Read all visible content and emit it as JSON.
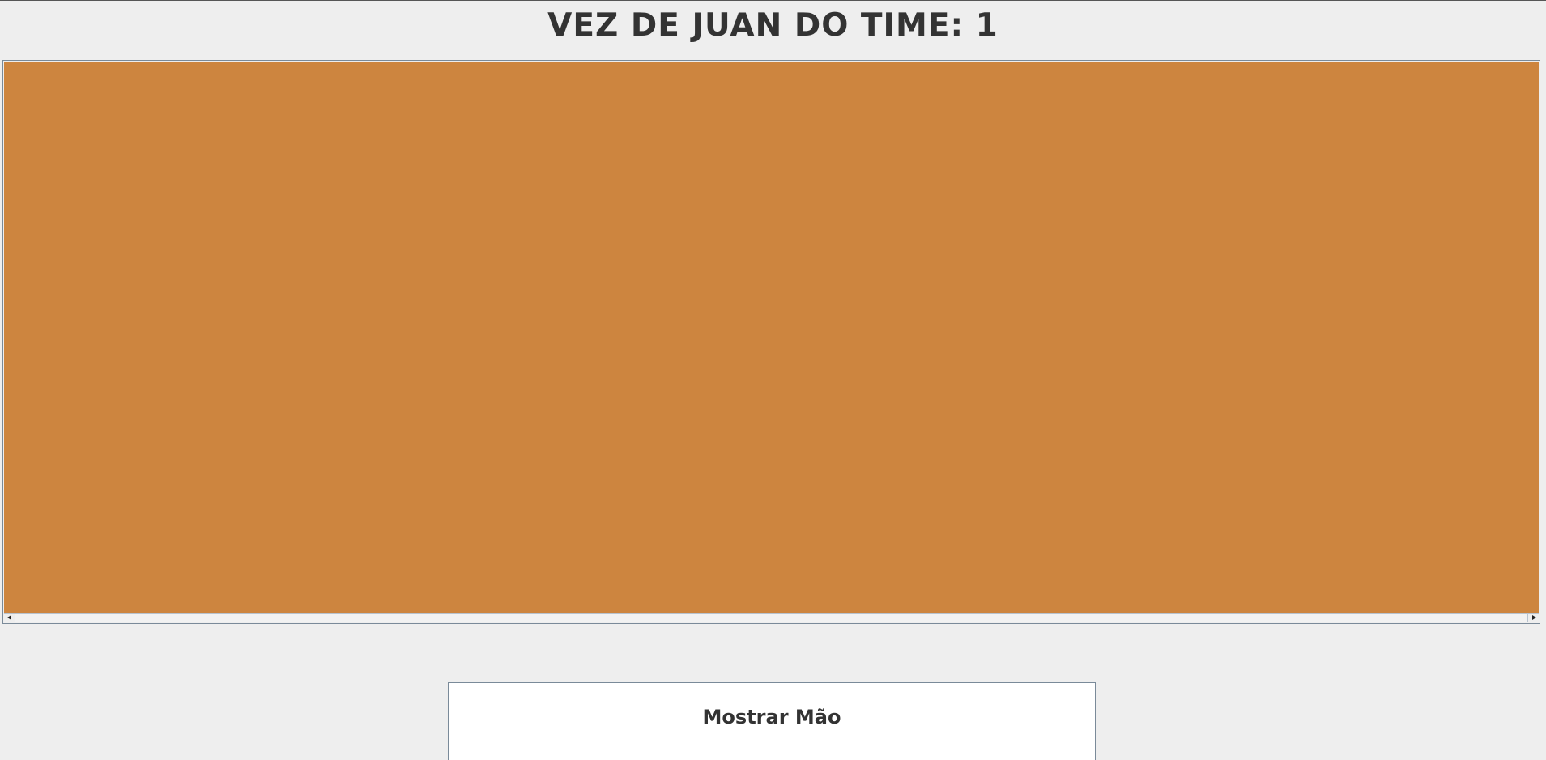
{
  "header": {
    "turn_title": "VEZ DE JUAN DO TIME: 1"
  },
  "board": {
    "table_color": "#cd853f",
    "scrollbar": {
      "left_icon": "arrow-left-icon",
      "right_icon": "arrow-right-icon"
    }
  },
  "actions": {
    "show_hand_label": "Mostrar Mão"
  }
}
